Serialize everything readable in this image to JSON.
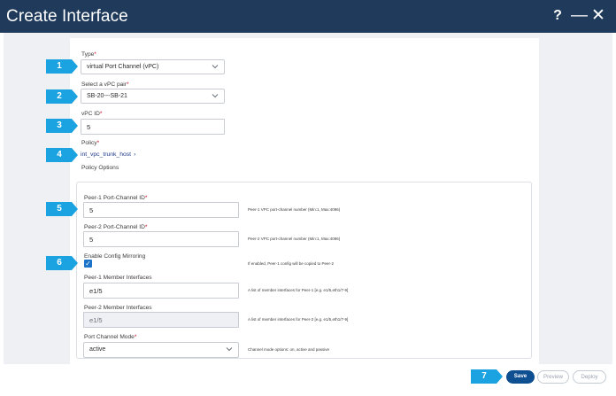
{
  "window": {
    "title": "Create Interface"
  },
  "titlebar": {
    "help_icon": "?",
    "minimize_icon": "—",
    "close_icon": "✕"
  },
  "form": {
    "type": {
      "label": "Type",
      "value": "virtual Port Channel (vPC)"
    },
    "vpc_pair": {
      "label": "Select a vPC pair",
      "value": "SB-20---SB-21"
    },
    "vpc_id": {
      "label": "vPC ID",
      "value": "5"
    },
    "policy": {
      "label": "Policy",
      "value": "int_vpc_trunk_host"
    },
    "policy_options_heading": "Policy Options",
    "peer1_port_channel_id": {
      "label": "Peer-1 Port-Channel ID",
      "value": "5",
      "help": "Peer-1 VPC port-channel number (Min:1, Max:4096)"
    },
    "peer2_port_channel_id": {
      "label": "Peer-2 Port-Channel ID",
      "value": "5",
      "help": "Peer-2 VPC port-channel number (Min:1, Max:4096)"
    },
    "config_mirroring": {
      "label": "Enable Config Mirroring",
      "checked": true,
      "help": "If enabled, Peer-1 config will be copied to Peer-2"
    },
    "peer1_member_interfaces": {
      "label": "Peer-1 Member Interfaces",
      "value": "e1/5",
      "help": "A list of member interfaces for Peer-1 [e.g. e1/5,eth1/7-9]"
    },
    "peer2_member_interfaces": {
      "label": "Peer-2 Member Interfaces",
      "value": "e1/5",
      "help": "A list of member interfaces for Peer-2 [e.g. e1/5,eth1/7-9]"
    },
    "port_channel_mode": {
      "label": "Port Channel Mode",
      "value": "active",
      "help": "Channel mode options: on, active and passive"
    },
    "required_mark": "*"
  },
  "badges": [
    "1",
    "2",
    "3",
    "4",
    "5",
    "6",
    "7"
  ],
  "footer": {
    "save": "Save",
    "preview": "Preview",
    "deploy": "Deploy"
  },
  "colors": {
    "titlebar": "#1f3a5a",
    "badge": "#1aa3e0",
    "primary_button": "#0e4f92",
    "checkbox": "#1a73c8",
    "required": "#d0021b"
  }
}
